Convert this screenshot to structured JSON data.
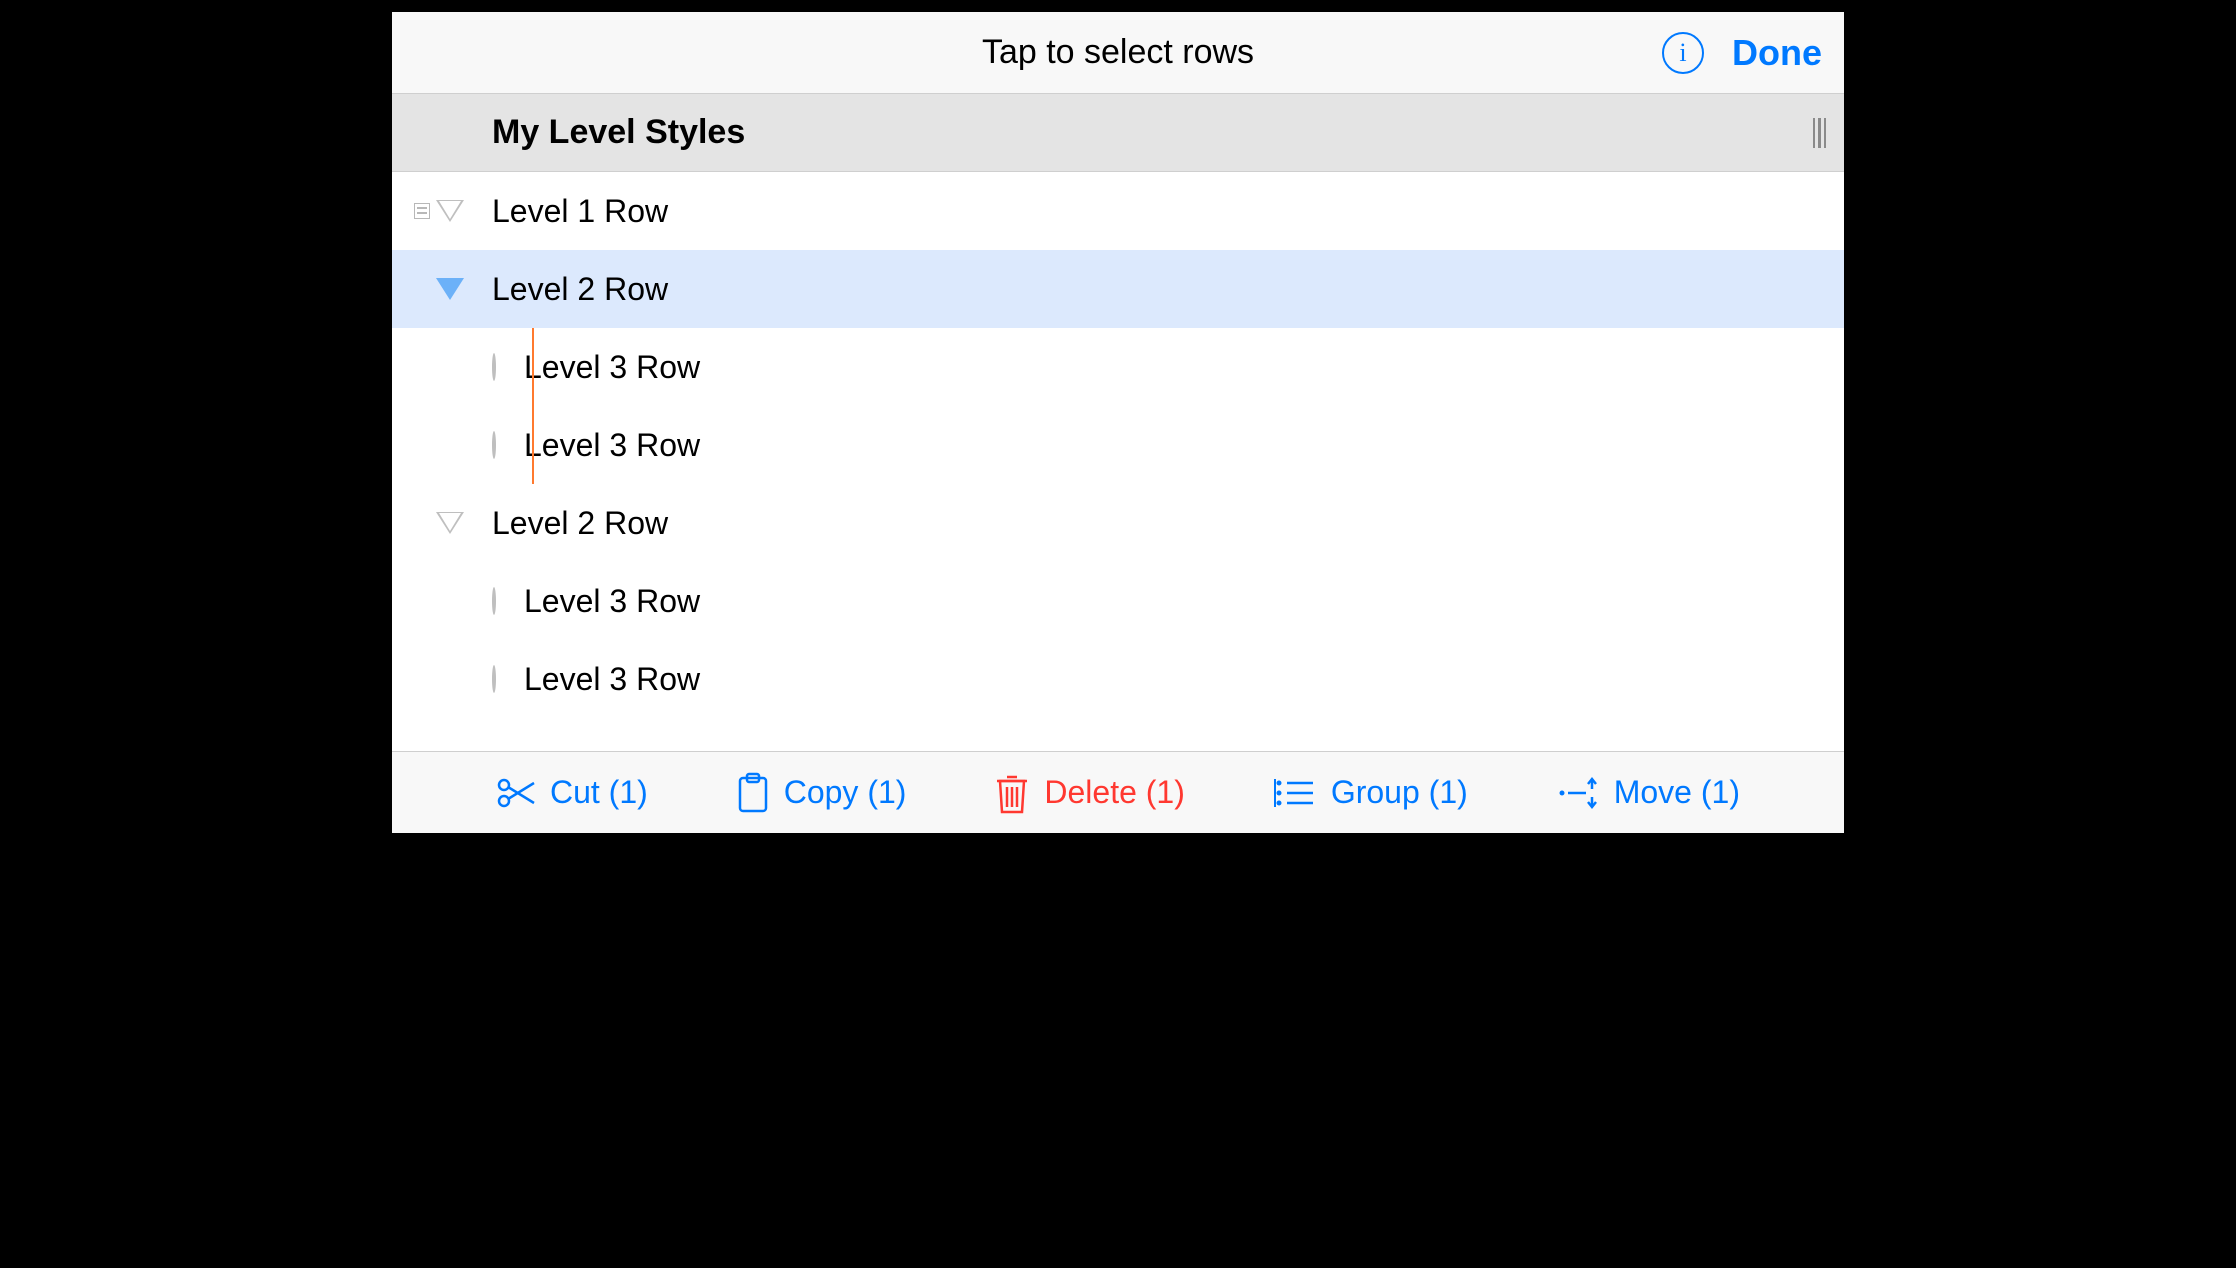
{
  "colors": {
    "accent": "#0079ff",
    "danger": "#ff3830",
    "selected": "#dce9fd"
  },
  "topbar": {
    "title": "Tap to select rows",
    "done_label": "Done"
  },
  "section": {
    "title": "My Level Styles"
  },
  "rows": [
    {
      "label": "Level 1 Row",
      "level": 1,
      "handle": "tri-outline-note",
      "selected": false
    },
    {
      "label": "Level 2 Row",
      "level": 2,
      "handle": "tri-blue",
      "selected": true
    },
    {
      "label": "Level 3 Row",
      "level": 3,
      "handle": "circle",
      "selected": false,
      "cursor": true
    },
    {
      "label": "Level 3 Row",
      "level": 3,
      "handle": "circle",
      "selected": false,
      "cursor": true
    },
    {
      "label": "Level 2 Row",
      "level": 2,
      "handle": "tri-outline",
      "selected": false
    },
    {
      "label": "Level 3 Row",
      "level": 3,
      "handle": "circle",
      "selected": false
    },
    {
      "label": "Level 3 Row",
      "level": 3,
      "handle": "circle",
      "selected": false
    }
  ],
  "toolbar": {
    "cut": {
      "label": "Cut (1)"
    },
    "copy": {
      "label": "Copy (1)"
    },
    "delete": {
      "label": "Delete (1)"
    },
    "group": {
      "label": "Group (1)"
    },
    "move": {
      "label": "Move (1)"
    }
  }
}
